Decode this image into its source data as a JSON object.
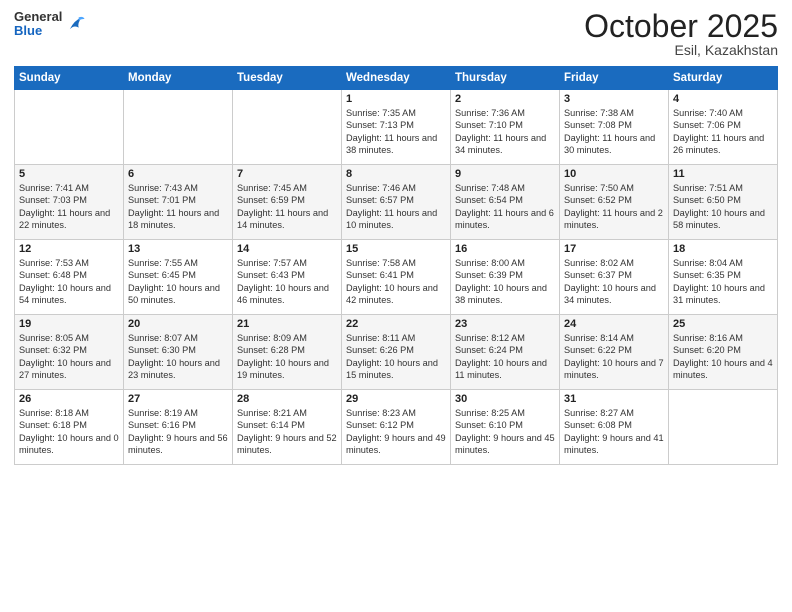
{
  "header": {
    "logo": {
      "general": "General",
      "blue": "Blue"
    },
    "title": "October 2025",
    "subtitle": "Esil, Kazakhstan"
  },
  "weekdays": [
    "Sunday",
    "Monday",
    "Tuesday",
    "Wednesday",
    "Thursday",
    "Friday",
    "Saturday"
  ],
  "weeks": [
    [
      {
        "day": "",
        "info": ""
      },
      {
        "day": "",
        "info": ""
      },
      {
        "day": "",
        "info": ""
      },
      {
        "day": "1",
        "info": "Sunrise: 7:35 AM\nSunset: 7:13 PM\nDaylight: 11 hours\nand 38 minutes."
      },
      {
        "day": "2",
        "info": "Sunrise: 7:36 AM\nSunset: 7:10 PM\nDaylight: 11 hours\nand 34 minutes."
      },
      {
        "day": "3",
        "info": "Sunrise: 7:38 AM\nSunset: 7:08 PM\nDaylight: 11 hours\nand 30 minutes."
      },
      {
        "day": "4",
        "info": "Sunrise: 7:40 AM\nSunset: 7:06 PM\nDaylight: 11 hours\nand 26 minutes."
      }
    ],
    [
      {
        "day": "5",
        "info": "Sunrise: 7:41 AM\nSunset: 7:03 PM\nDaylight: 11 hours\nand 22 minutes."
      },
      {
        "day": "6",
        "info": "Sunrise: 7:43 AM\nSunset: 7:01 PM\nDaylight: 11 hours\nand 18 minutes."
      },
      {
        "day": "7",
        "info": "Sunrise: 7:45 AM\nSunset: 6:59 PM\nDaylight: 11 hours\nand 14 minutes."
      },
      {
        "day": "8",
        "info": "Sunrise: 7:46 AM\nSunset: 6:57 PM\nDaylight: 11 hours\nand 10 minutes."
      },
      {
        "day": "9",
        "info": "Sunrise: 7:48 AM\nSunset: 6:54 PM\nDaylight: 11 hours\nand 6 minutes."
      },
      {
        "day": "10",
        "info": "Sunrise: 7:50 AM\nSunset: 6:52 PM\nDaylight: 11 hours\nand 2 minutes."
      },
      {
        "day": "11",
        "info": "Sunrise: 7:51 AM\nSunset: 6:50 PM\nDaylight: 10 hours\nand 58 minutes."
      }
    ],
    [
      {
        "day": "12",
        "info": "Sunrise: 7:53 AM\nSunset: 6:48 PM\nDaylight: 10 hours\nand 54 minutes."
      },
      {
        "day": "13",
        "info": "Sunrise: 7:55 AM\nSunset: 6:45 PM\nDaylight: 10 hours\nand 50 minutes."
      },
      {
        "day": "14",
        "info": "Sunrise: 7:57 AM\nSunset: 6:43 PM\nDaylight: 10 hours\nand 46 minutes."
      },
      {
        "day": "15",
        "info": "Sunrise: 7:58 AM\nSunset: 6:41 PM\nDaylight: 10 hours\nand 42 minutes."
      },
      {
        "day": "16",
        "info": "Sunrise: 8:00 AM\nSunset: 6:39 PM\nDaylight: 10 hours\nand 38 minutes."
      },
      {
        "day": "17",
        "info": "Sunrise: 8:02 AM\nSunset: 6:37 PM\nDaylight: 10 hours\nand 34 minutes."
      },
      {
        "day": "18",
        "info": "Sunrise: 8:04 AM\nSunset: 6:35 PM\nDaylight: 10 hours\nand 31 minutes."
      }
    ],
    [
      {
        "day": "19",
        "info": "Sunrise: 8:05 AM\nSunset: 6:32 PM\nDaylight: 10 hours\nand 27 minutes."
      },
      {
        "day": "20",
        "info": "Sunrise: 8:07 AM\nSunset: 6:30 PM\nDaylight: 10 hours\nand 23 minutes."
      },
      {
        "day": "21",
        "info": "Sunrise: 8:09 AM\nSunset: 6:28 PM\nDaylight: 10 hours\nand 19 minutes."
      },
      {
        "day": "22",
        "info": "Sunrise: 8:11 AM\nSunset: 6:26 PM\nDaylight: 10 hours\nand 15 minutes."
      },
      {
        "day": "23",
        "info": "Sunrise: 8:12 AM\nSunset: 6:24 PM\nDaylight: 10 hours\nand 11 minutes."
      },
      {
        "day": "24",
        "info": "Sunrise: 8:14 AM\nSunset: 6:22 PM\nDaylight: 10 hours\nand 7 minutes."
      },
      {
        "day": "25",
        "info": "Sunrise: 8:16 AM\nSunset: 6:20 PM\nDaylight: 10 hours\nand 4 minutes."
      }
    ],
    [
      {
        "day": "26",
        "info": "Sunrise: 8:18 AM\nSunset: 6:18 PM\nDaylight: 10 hours\nand 0 minutes."
      },
      {
        "day": "27",
        "info": "Sunrise: 8:19 AM\nSunset: 6:16 PM\nDaylight: 9 hours\nand 56 minutes."
      },
      {
        "day": "28",
        "info": "Sunrise: 8:21 AM\nSunset: 6:14 PM\nDaylight: 9 hours\nand 52 minutes."
      },
      {
        "day": "29",
        "info": "Sunrise: 8:23 AM\nSunset: 6:12 PM\nDaylight: 9 hours\nand 49 minutes."
      },
      {
        "day": "30",
        "info": "Sunrise: 8:25 AM\nSunset: 6:10 PM\nDaylight: 9 hours\nand 45 minutes."
      },
      {
        "day": "31",
        "info": "Sunrise: 8:27 AM\nSunset: 6:08 PM\nDaylight: 9 hours\nand 41 minutes."
      },
      {
        "day": "",
        "info": ""
      }
    ]
  ]
}
